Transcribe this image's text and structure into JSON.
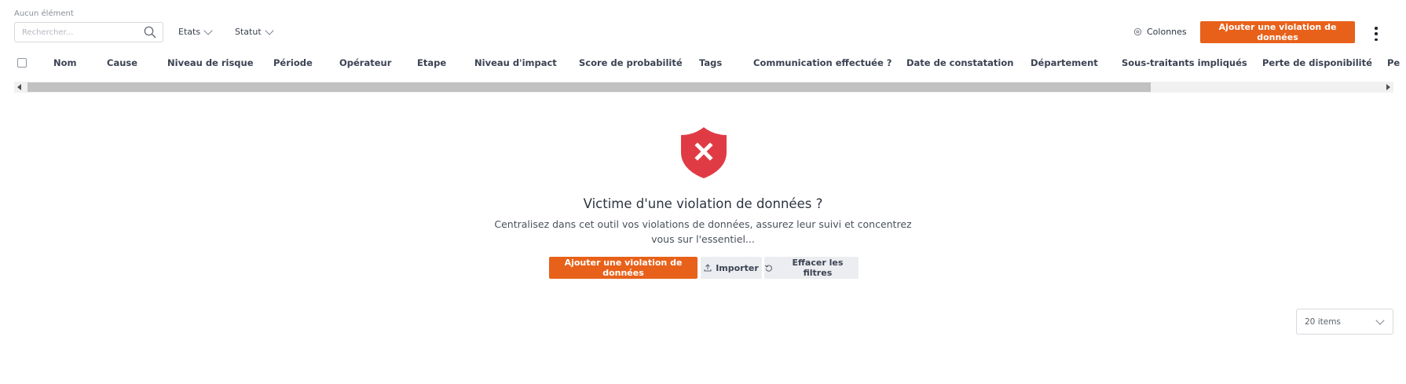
{
  "toolbar": {
    "item_count": "Aucun élément",
    "search_placeholder": "Rechercher...",
    "filters": [
      "Etats",
      "Statut"
    ],
    "columns_label": "Colonnes",
    "add_label": "Ajouter une violation de données"
  },
  "table": {
    "headers": [
      "Nom",
      "Cause",
      "Niveau de risque",
      "Période",
      "Opérateur",
      "Etape",
      "Niveau d'impact",
      "Score de probabilité",
      "Tags",
      "Communication effectuée ?",
      "Date de constatation",
      "Département",
      "Sous-traitants impliqués",
      "Perte de disponibilité",
      "Pe"
    ]
  },
  "empty_state": {
    "title": "Victime d'une violation de données ?",
    "description": "Centralisez dans cet outil vos violations de données, assurez leur suivi et concentrez vous sur l'essentiel...",
    "add_label": "Ajouter une violation de données",
    "import_label": "Importer",
    "clear_label": "Effacer les filtres"
  },
  "pagination": {
    "page_size": "20 items"
  },
  "colors": {
    "accent": "#e8611a",
    "shield": "#e03b45"
  },
  "icons": [
    "search-icon",
    "chevron-down-icon",
    "columns-icon",
    "kebab-menu-icon",
    "shield-x-icon",
    "upload-icon",
    "reset-icon"
  ]
}
